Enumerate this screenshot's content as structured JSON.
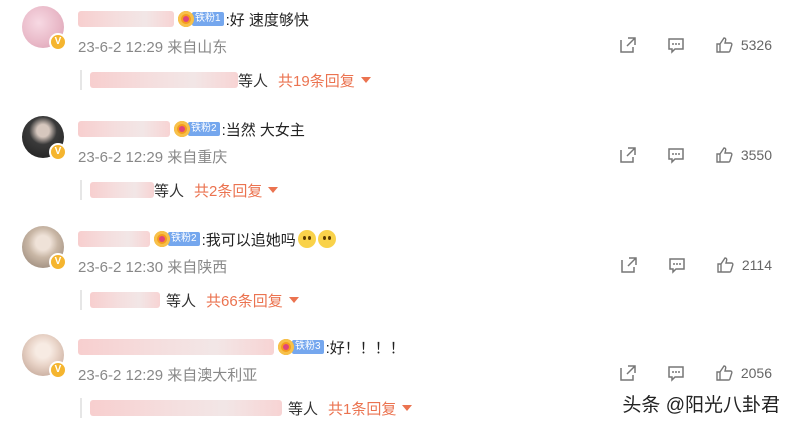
{
  "comments": [
    {
      "text": ":好 速度够快",
      "fan_level": "铁粉1",
      "time": "23-6-2 12:29",
      "location": "来自山东",
      "likes": "5326",
      "replies": {
        "suffix": "等人",
        "count": "共19条回复"
      },
      "avatar_color": "#e8b7c6"
    },
    {
      "text": ":当然 大女主",
      "fan_level": "铁粉2",
      "time": "23-6-2 12:29",
      "location": "来自重庆",
      "likes": "3550",
      "replies": {
        "suffix": "等人",
        "count": "共2条回复"
      },
      "avatar_color": "#3a3a3a"
    },
    {
      "text": ":我可以追她吗",
      "fan_level": "铁粉2",
      "time": "23-6-2 12:30",
      "location": "来自陕西",
      "likes": "2114",
      "replies": {
        "suffix": "等人",
        "count": "共66条回复"
      },
      "avatar_color": "#c9b7a6"
    },
    {
      "text": ":好！！！！",
      "fan_level": "铁粉3",
      "time": "23-6-2 12:29",
      "location": "来自澳大利亚",
      "likes": "2056",
      "replies": {
        "suffix": "等人",
        "count": "共1条回复"
      },
      "avatar_color": "#e9d4c8"
    }
  ],
  "watermark": "头条 @阳光八卦君",
  "colors": {
    "accent": "#eb7350",
    "meta": "#888888",
    "fan_tag": "#75a7ee"
  },
  "icons": [
    "share-icon",
    "comment-icon",
    "like-icon",
    "chevron-down-icon",
    "verified-icon",
    "crown-icon",
    "emoji-icon"
  ]
}
